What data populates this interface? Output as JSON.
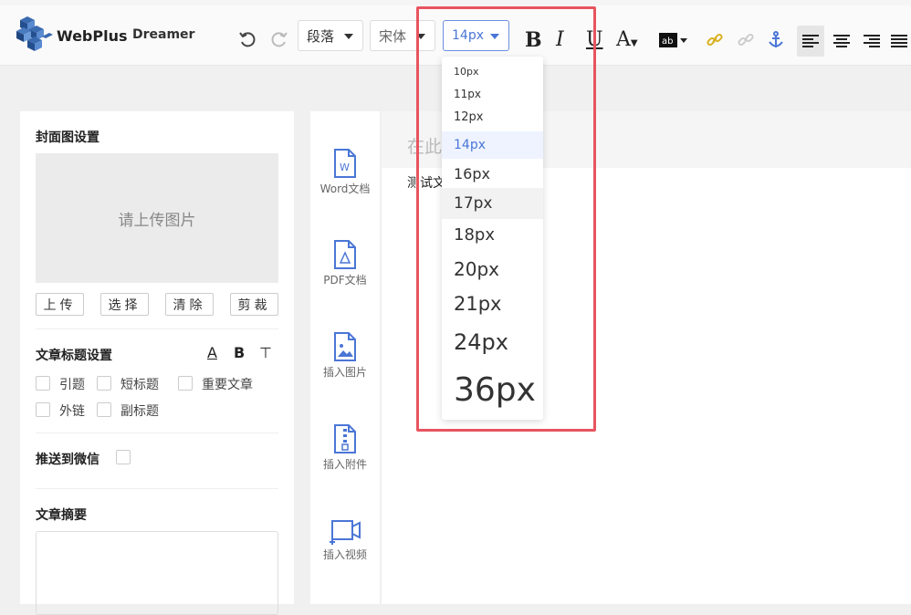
{
  "header": {
    "brand": "WebPlus",
    "user": "Dreamer",
    "paragraph_select": "段落",
    "font_select": "宋体",
    "size_select": "14px",
    "accent": "#4a76d6"
  },
  "toolbar_icons": [
    "undo-icon",
    "redo-icon",
    "bold-icon",
    "italic-icon",
    "underline-icon",
    "font-color-icon",
    "highlight-icon",
    "link-icon",
    "unlink-icon",
    "anchor-icon",
    "align-left-icon",
    "align-center-icon",
    "align-right-icon",
    "align-justify-icon"
  ],
  "font_size_dropdown": {
    "options": [
      "10px",
      "11px",
      "12px",
      "14px",
      "16px",
      "17px",
      "18px",
      "20px",
      "21px",
      "24px",
      "36px"
    ],
    "selected": "14px",
    "hovered": "17px"
  },
  "left_panel": {
    "cover_title": "封面图设置",
    "upload_placeholder": "请上传图片",
    "buttons": [
      "上传",
      "选择",
      "清除",
      "剪裁"
    ],
    "title_settings": "文章标题设置",
    "title_tools": [
      "A",
      "B",
      "⊤"
    ],
    "checkboxes_row1": [
      "引题",
      "短标题",
      "重要文章"
    ],
    "checkboxes_row2": [
      "外链",
      "副标题"
    ],
    "push_wechat": "推送到微信",
    "summary_title": "文章摘要"
  },
  "mid_toolbar": [
    "Word文档",
    "PDF文档",
    "插入图片",
    "插入附件",
    "插入视频"
  ],
  "editor": {
    "title_placeholder": "在此输入标题",
    "body_text": "测试文"
  }
}
